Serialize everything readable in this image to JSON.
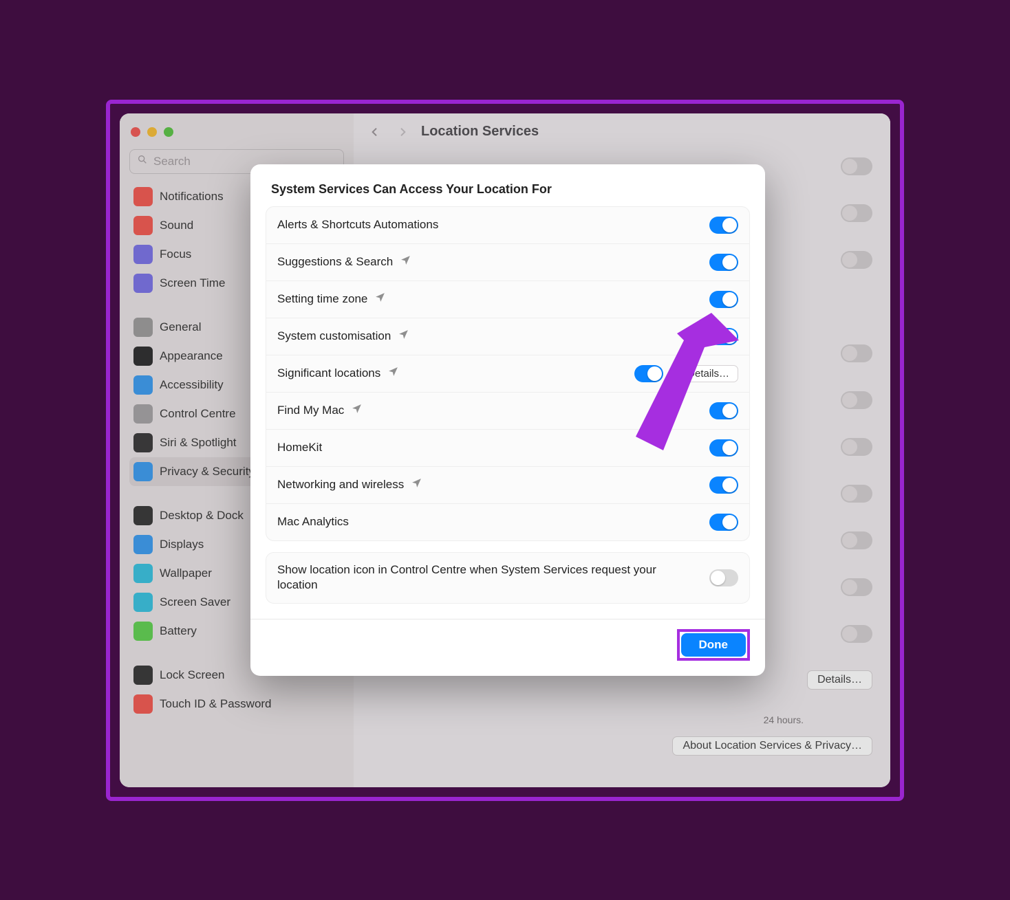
{
  "window": {
    "search_placeholder": "Search",
    "title": "Location Services"
  },
  "sidebar": {
    "items": [
      {
        "label": "Notifications",
        "color": "#f25b53"
      },
      {
        "label": "Sound",
        "color": "#f25b53"
      },
      {
        "label": "Focus",
        "color": "#7b74e6"
      },
      {
        "label": "Screen Time",
        "color": "#7b74e6"
      },
      {
        "gap": true
      },
      {
        "label": "General",
        "color": "#9e9c9d"
      },
      {
        "label": "Appearance",
        "color": "#2f2f30"
      },
      {
        "label": "Accessibility",
        "color": "#3e9cf0"
      },
      {
        "label": "Control Centre",
        "color": "#a6a3a5"
      },
      {
        "label": "Siri & Spotlight",
        "color": "#3c3b3c"
      },
      {
        "label": "Privacy & Security",
        "color": "#3e9cf0",
        "selected": true
      },
      {
        "gap": true
      },
      {
        "label": "Desktop & Dock",
        "color": "#3a393a"
      },
      {
        "label": "Displays",
        "color": "#3e9cf0"
      },
      {
        "label": "Wallpaper",
        "color": "#3bc2e0"
      },
      {
        "label": "Screen Saver",
        "color": "#3bc2e0"
      },
      {
        "label": "Battery",
        "color": "#62d154"
      },
      {
        "gap": true
      },
      {
        "label": "Lock Screen",
        "color": "#3a393a"
      },
      {
        "label": "Touch ID & Password",
        "color": "#f25b53"
      }
    ]
  },
  "modal": {
    "title": "System Services Can Access Your Location For",
    "services": [
      {
        "label": "Alerts & Shortcuts Automations",
        "arrow": false,
        "on": true
      },
      {
        "label": "Suggestions & Search",
        "arrow": true,
        "on": true
      },
      {
        "label": "Setting time zone",
        "arrow": true,
        "on": true
      },
      {
        "label": "System customisation",
        "arrow": true,
        "on": true
      },
      {
        "label": "Significant locations",
        "arrow": true,
        "on": true,
        "details": true
      },
      {
        "label": "Find My Mac",
        "arrow": true,
        "on": true
      },
      {
        "label": "HomeKit",
        "arrow": false,
        "on": true
      },
      {
        "label": "Networking and wireless",
        "arrow": true,
        "on": true
      },
      {
        "label": "Mac Analytics",
        "arrow": false,
        "on": true
      }
    ],
    "show_icon_row": {
      "label": "Show location icon in Control Centre when System Services request your location",
      "on": false
    },
    "details_label": "Details…",
    "done_label": "Done"
  },
  "background": {
    "details_label": "Details…",
    "about_label": "About Location Services & Privacy…",
    "hours_text": "24 hours."
  }
}
